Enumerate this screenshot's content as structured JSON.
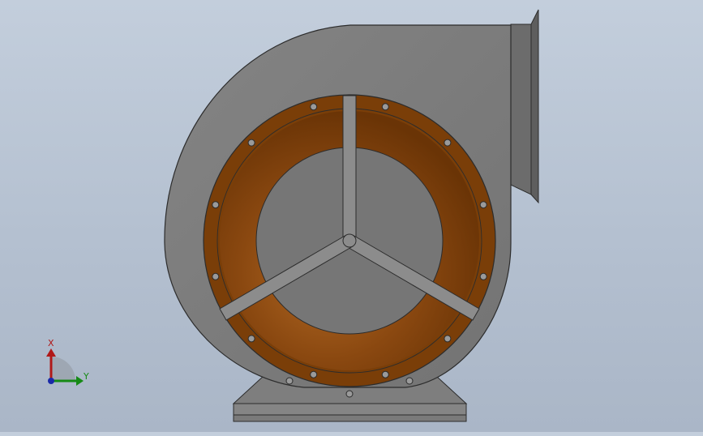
{
  "viewport": {
    "background_top": "#c3cedc",
    "background_bottom": "#aab6c7"
  },
  "model": {
    "housing_color": "#7b7b7b",
    "housing_edge_color": "#2c2c2c",
    "outlet_color": "#6a6a6a",
    "inlet_ring_color": "#7a3e08",
    "inlet_ring_highlight": "#a8611e",
    "inlet_core_color": "#767676",
    "spoke_color": "#8a8a8a",
    "base_color": "#808080",
    "bolt_count_ring": 12,
    "spoke_count": 3
  },
  "triad": {
    "x_label": "X",
    "y_label": "Y",
    "x_color": "#b01818",
    "y_color": "#168a16",
    "z_color": "#1a2aa8"
  }
}
